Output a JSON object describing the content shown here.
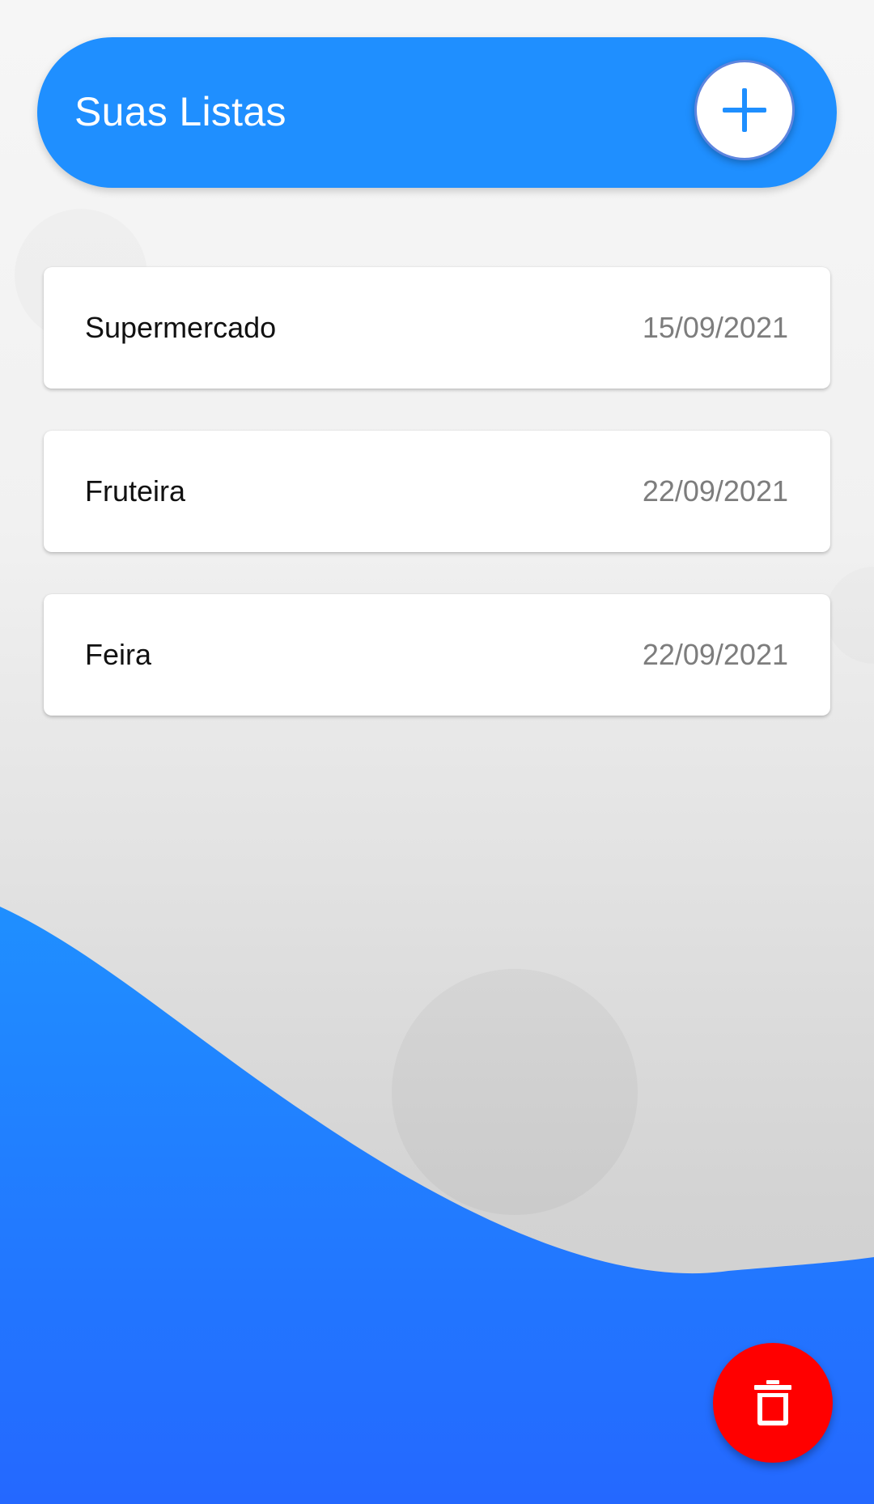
{
  "header": {
    "title": "Suas Listas",
    "add_icon": "plus-icon"
  },
  "lists": [
    {
      "name": "Supermercado",
      "date": "15/09/2021"
    },
    {
      "name": "Fruteira",
      "date": "22/09/2021"
    },
    {
      "name": "Feira",
      "date": "22/09/2021"
    }
  ],
  "actions": {
    "delete_icon": "trash-icon"
  },
  "colors": {
    "primary_blue": "#1F8FFF",
    "wave_blue_bottom": "#2468FF",
    "delete_red": "#FF0000",
    "date_gray": "#7D7D7D"
  }
}
